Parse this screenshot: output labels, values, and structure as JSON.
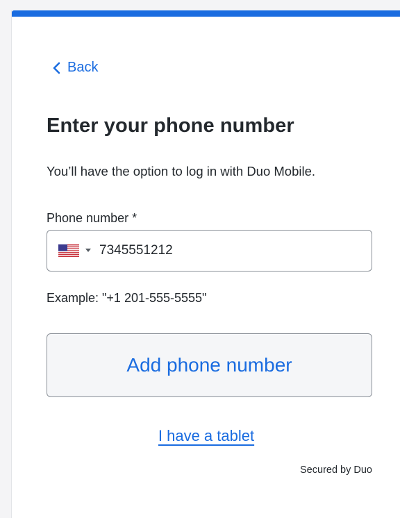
{
  "nav": {
    "back_label": "Back"
  },
  "page": {
    "title": "Enter your phone number",
    "description": "You’ll have the option to log in with Duo Mobile."
  },
  "phone_field": {
    "label": "Phone number *",
    "country_flag": "us-flag-icon",
    "value": "7345551212",
    "example": "Example: \"+1 201-555-5555\""
  },
  "actions": {
    "add_phone_label": "Add phone number",
    "tablet_link": "I have a tablet"
  },
  "footer": {
    "secured_by": "Secured by Duo"
  },
  "colors": {
    "accent": "#1a6ce0",
    "text": "#23282d",
    "border": "#8a9098",
    "button_bg": "#f5f6f8"
  }
}
